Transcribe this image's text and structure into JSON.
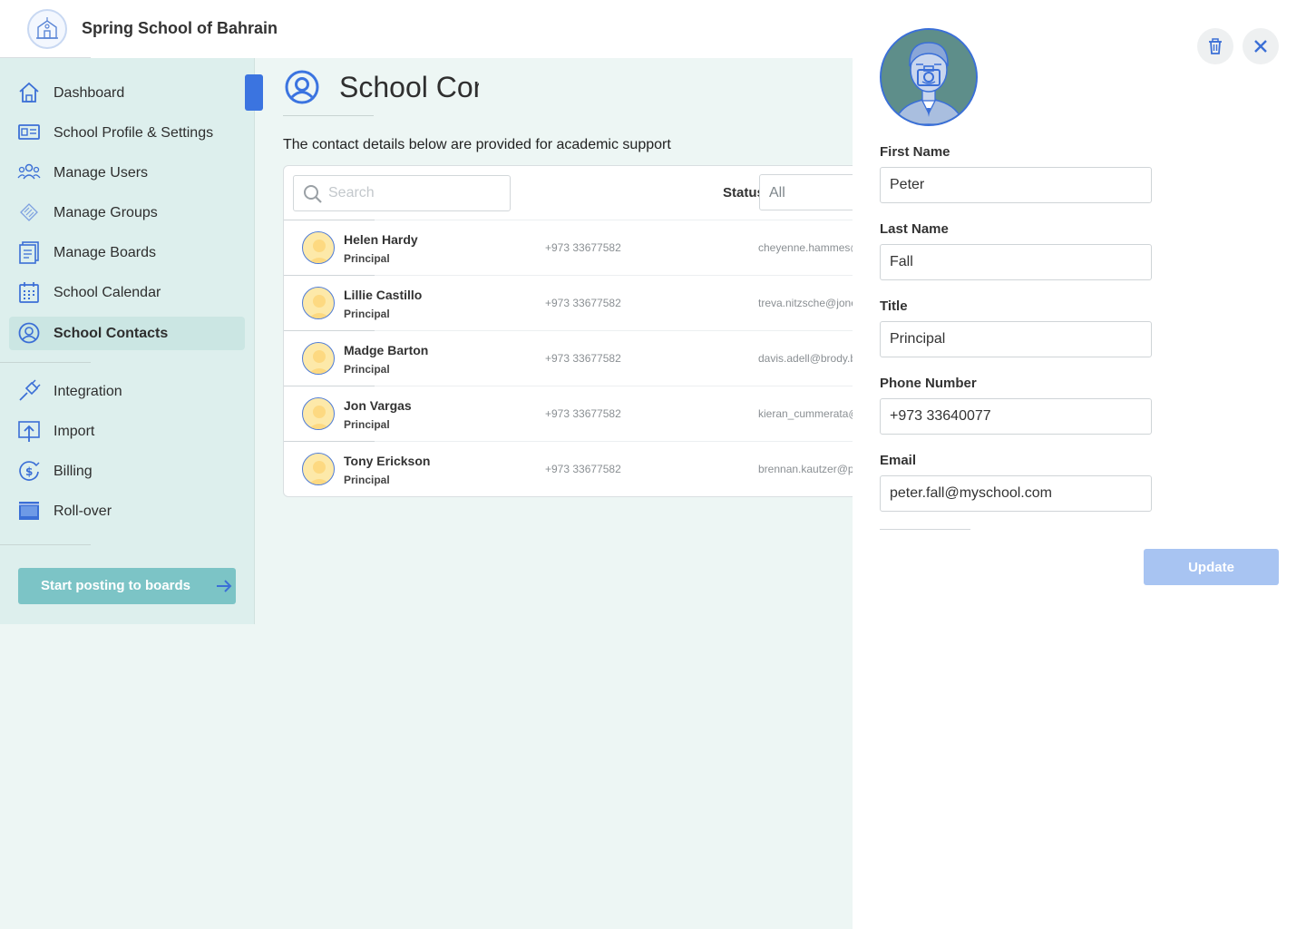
{
  "app": {
    "school_name": "Spring School of Bahrain"
  },
  "sidebar": {
    "items": [
      {
        "label": "Dashboard",
        "icon": "home-icon"
      },
      {
        "label": "School Profile & Settings",
        "icon": "id-card-icon"
      },
      {
        "label": "Manage Users",
        "icon": "users-icon"
      },
      {
        "label": "Manage Groups",
        "icon": "groups-icon"
      },
      {
        "label": "Manage Boards",
        "icon": "boards-icon"
      },
      {
        "label": "School Calendar",
        "icon": "calendar-icon"
      },
      {
        "label": "School Contacts",
        "icon": "contact-icon",
        "active": true
      },
      {
        "label": "Integration",
        "icon": "plug-icon"
      },
      {
        "label": "Import",
        "icon": "import-icon"
      },
      {
        "label": "Billing",
        "icon": "billing-icon"
      },
      {
        "label": "Roll-over",
        "icon": "rollover-icon"
      }
    ],
    "cta_label": "Start posting to boards"
  },
  "main": {
    "title": "School Contacts",
    "intro": "The contact details below are provided for academic support",
    "search_placeholder": "Search",
    "status_label": "Status",
    "status_value": "All",
    "contacts": [
      {
        "name": "Helen Hardy",
        "title": "Principal",
        "phone": "+973 33677582",
        "email": "cheyenne.hammes@"
      },
      {
        "name": "Lillie Castillo",
        "title": "Principal",
        "phone": "+973 33677582",
        "email": "treva.nitzsche@jone"
      },
      {
        "name": "Madge Barton",
        "title": "Principal",
        "phone": "+973 33677582",
        "email": "davis.adell@brody.b"
      },
      {
        "name": "Jon Vargas",
        "title": "Principal",
        "phone": "+973 33677582",
        "email": "kieran_cummerata@"
      },
      {
        "name": "Tony Erickson",
        "title": "Principal",
        "phone": "+973 33677582",
        "email": "brennan.kautzer@p"
      }
    ]
  },
  "panel": {
    "first_name_label": "First Name",
    "first_name_value": "Peter",
    "last_name_label": "Last Name",
    "last_name_value": "Fall",
    "title_label": "Title",
    "title_value": "Principal",
    "phone_label": "Phone Number",
    "phone_value": "+973 33640077",
    "email_label": "Email",
    "email_value": "peter.fall@myschool.com",
    "update_label": "Update"
  },
  "colors": {
    "accent": "#3b74e0",
    "sidebar_bg": "#ddefed",
    "cta_bg": "#7cc4c6",
    "update_disabled": "#a8c4f2"
  }
}
